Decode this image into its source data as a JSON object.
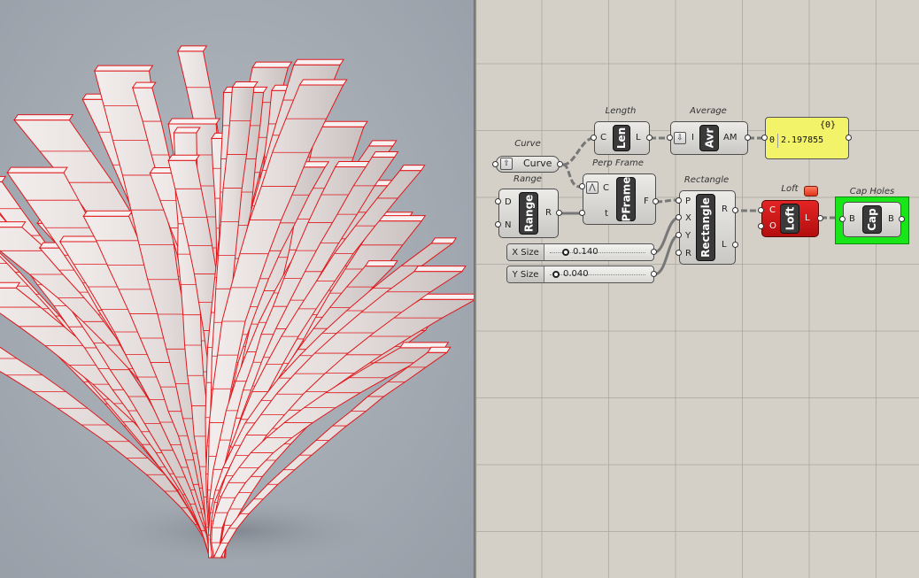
{
  "viewport": {
    "background": "#a7adb5",
    "mesh_color": "#e0171b",
    "surface_color": "#ede7e6"
  },
  "canvas": {
    "background": "#d4d0c8",
    "components": {
      "curve": {
        "title": "Curve",
        "label": "Curve",
        "icon": "up-arrow-icon"
      },
      "range": {
        "title": "Range",
        "nick": "Range",
        "inputs": [
          "D",
          "N"
        ],
        "outputs": [
          "R"
        ]
      },
      "length": {
        "title": "Length",
        "nick": "Len",
        "inputs": [
          "C"
        ],
        "outputs": [
          "L"
        ]
      },
      "perp_frame": {
        "title": "Perp Frame",
        "nick": "PFrame",
        "inputs": [
          "C",
          "t"
        ],
        "outputs": [
          "F"
        ]
      },
      "average": {
        "title": "Average",
        "nick": "Avr",
        "inputs": [
          "I"
        ],
        "outputs": [
          "AM"
        ]
      },
      "panel": {
        "header": "{0}",
        "index": "0",
        "value": "2.197855",
        "color": "#f3f36a"
      },
      "rectangle": {
        "title": "Rectangle",
        "nick": "Rectangle",
        "inputs": [
          "P",
          "X",
          "Y",
          "R"
        ],
        "outputs": [
          "R",
          "L"
        ]
      },
      "loft": {
        "title": "Loft",
        "nick": "Loft",
        "inputs": [
          "C",
          "O"
        ],
        "outputs": [
          "L"
        ],
        "color": "#d01515"
      },
      "cap_holes": {
        "title": "Cap Holes",
        "nick": "Cap",
        "inputs": [
          "B"
        ],
        "outputs": [
          "B"
        ],
        "highlight": "#19e619"
      },
      "x_size": {
        "label": "X Size",
        "value": "0.140",
        "fraction": 0.14
      },
      "y_size": {
        "label": "Y Size",
        "value": "0.040",
        "fraction": 0.04
      }
    }
  }
}
